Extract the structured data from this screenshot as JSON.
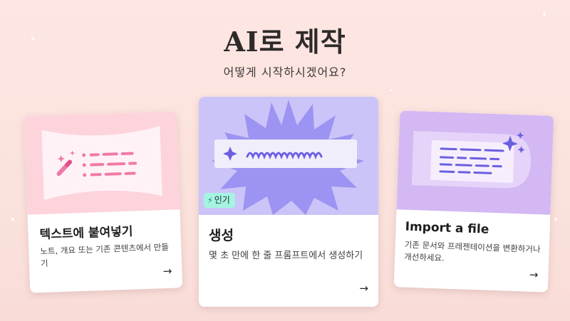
{
  "header": {
    "title": "AI로 제작",
    "subtitle": "어떻게 시작하시겠어요?"
  },
  "cards": [
    {
      "title": "텍스트에 붙여넣기",
      "description": "노트, 개요 또는 기존 콘텐츠에서 만들기",
      "arrow": "→",
      "icon": "magic-wand-icon"
    },
    {
      "title": "생성",
      "description": "몇 초 만에 한 줄 프롬프트에서 생성하기",
      "arrow": "→",
      "badge": "인기",
      "badge_icon": "⚡",
      "icon": "sparkle-icon"
    },
    {
      "title": "Import a file",
      "description": "기존 문서와 프레젠테이션을 변환하거나 개선하세요.",
      "arrow": "→",
      "icon": "sparkle-icon"
    }
  ],
  "colors": {
    "background": "#fde6e3",
    "card1_art": "#fdd3dc",
    "card2_art": "#cbc4f8",
    "card3_art": "#d3b8f3",
    "badge": "#a6f3e2",
    "accent_pink": "#f07aa7",
    "accent_purple": "#6b5fe0"
  }
}
